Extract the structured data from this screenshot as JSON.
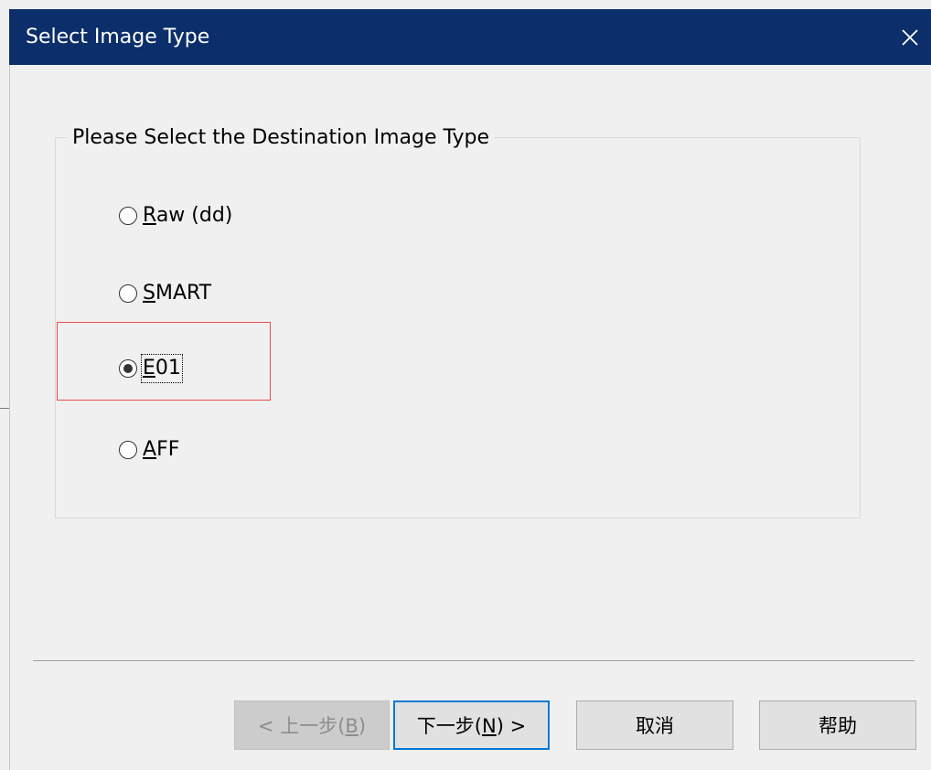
{
  "window": {
    "title": "Select Image Type",
    "close_glyph": "✕"
  },
  "group": {
    "title": "Please Select the Destination Image Type"
  },
  "options": [
    {
      "mnemonic": "R",
      "rest": "aw (dd)",
      "checked": false
    },
    {
      "mnemonic": "S",
      "rest": "MART",
      "checked": false
    },
    {
      "mnemonic": "E",
      "rest": "01",
      "checked": true
    },
    {
      "mnemonic": "A",
      "rest": "FF",
      "checked": false
    }
  ],
  "buttons": {
    "back": {
      "prefix": "< 上一步(",
      "mnemonic": "B",
      "suffix": ")",
      "disabled": true
    },
    "next": {
      "prefix": "下一步(",
      "mnemonic": "N",
      "suffix": ") >",
      "default": true
    },
    "cancel": {
      "label": "取消"
    },
    "help": {
      "label": "帮助"
    }
  },
  "icons": {
    "close": "close-icon",
    "radio_unchecked": "radio-unchecked-icon",
    "radio_checked": "radio-checked-icon"
  },
  "colors": {
    "titlebar": "#0c2e6a",
    "highlight": "#e84c4c",
    "default_button_border": "#0078d7"
  }
}
